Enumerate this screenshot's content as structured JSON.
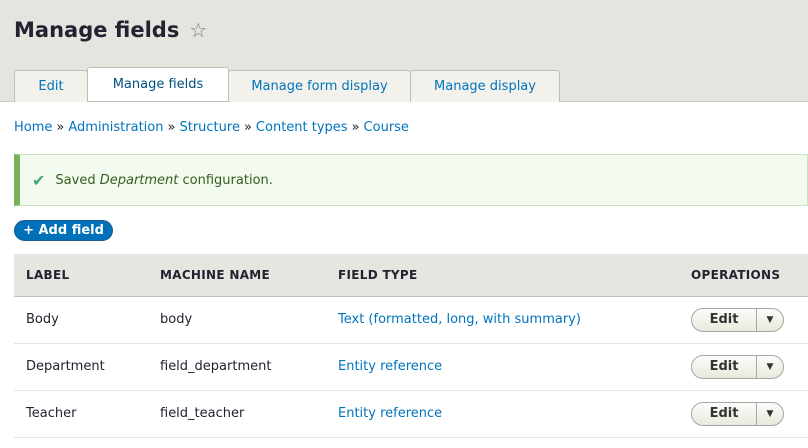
{
  "page": {
    "title": "Manage fields",
    "star_icon": "star-outline-icon"
  },
  "tabs": [
    {
      "label": "Edit",
      "active": false
    },
    {
      "label": "Manage fields",
      "active": true
    },
    {
      "label": "Manage form display",
      "active": false
    },
    {
      "label": "Manage display",
      "active": false
    }
  ],
  "breadcrumb": {
    "items": [
      "Home",
      "Administration",
      "Structure",
      "Content types",
      "Course"
    ],
    "separator": "»"
  },
  "message": {
    "prefix": "Saved",
    "emphasis": "Department",
    "suffix": "configuration.",
    "icon": "checkmark-icon",
    "color": "#77b259"
  },
  "actions": {
    "add_field_label": "+ Add field"
  },
  "table": {
    "headers": {
      "label": "LABEL",
      "machine_name": "MACHINE NAME",
      "field_type": "FIELD TYPE",
      "operations": "OPERATIONS"
    },
    "rows": [
      {
        "label": "Body",
        "machine_name": "body",
        "field_type": "Text (formatted, long, with summary)",
        "operation": "Edit"
      },
      {
        "label": "Department",
        "machine_name": "field_department",
        "field_type": "Entity reference",
        "operation": "Edit"
      },
      {
        "label": "Teacher",
        "machine_name": "field_teacher",
        "field_type": "Entity reference",
        "operation": "Edit"
      }
    ]
  },
  "colors": {
    "link": "#0074bd",
    "primary_button": "#0071b8",
    "header_bg": "#e6e4df"
  }
}
